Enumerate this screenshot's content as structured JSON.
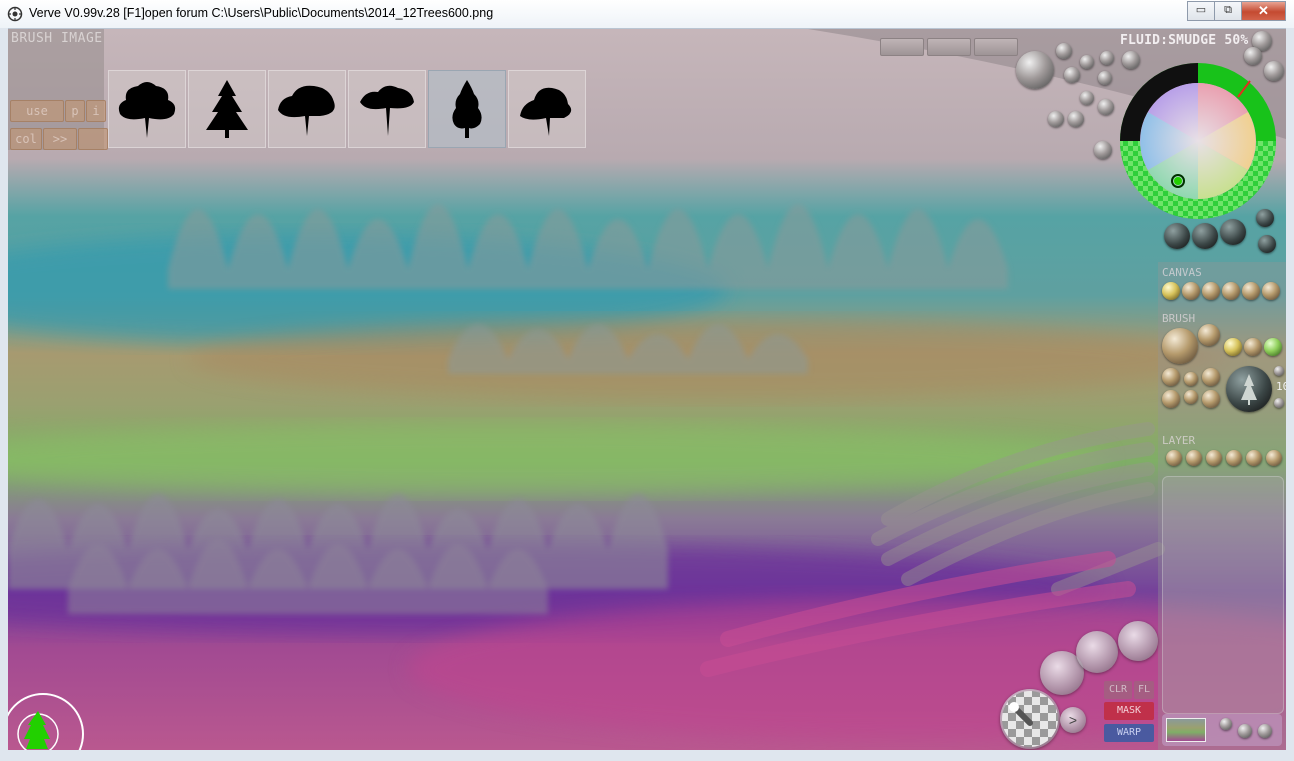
{
  "window": {
    "title": "Verve V0.99v.28 [F1]open forum   C:\\Users\\Public\\Documents\\2014_12Trees600.png",
    "minimize": "▭",
    "maximize": "⧉",
    "close": "✕"
  },
  "brush_image": {
    "title": "BRUSH IMAGE",
    "buttons": {
      "use": "use",
      "p": "p",
      "i": "i",
      "col": "col",
      "next": ">>",
      "blank": ""
    }
  },
  "mode": {
    "label": "FLUID:SMUDGE 50%"
  },
  "panels": {
    "canvas": "CANVAS",
    "brush": "BRUSH",
    "layer": "LAYER"
  },
  "brush_size_value": "10",
  "bottom_buttons": {
    "clr": "CLR",
    "fl": "FL",
    "mask": "MASK",
    "warp": "WARP",
    "arrow": ">"
  },
  "colors": {
    "accent_green": "#22d000",
    "mask_red": "#c0304a",
    "warp_blue": "#4a5aa0"
  },
  "icons": [
    "app-icon",
    "tree-thumbnail",
    "color-wheel",
    "checkerboard-icon",
    "brush-cursor"
  ]
}
